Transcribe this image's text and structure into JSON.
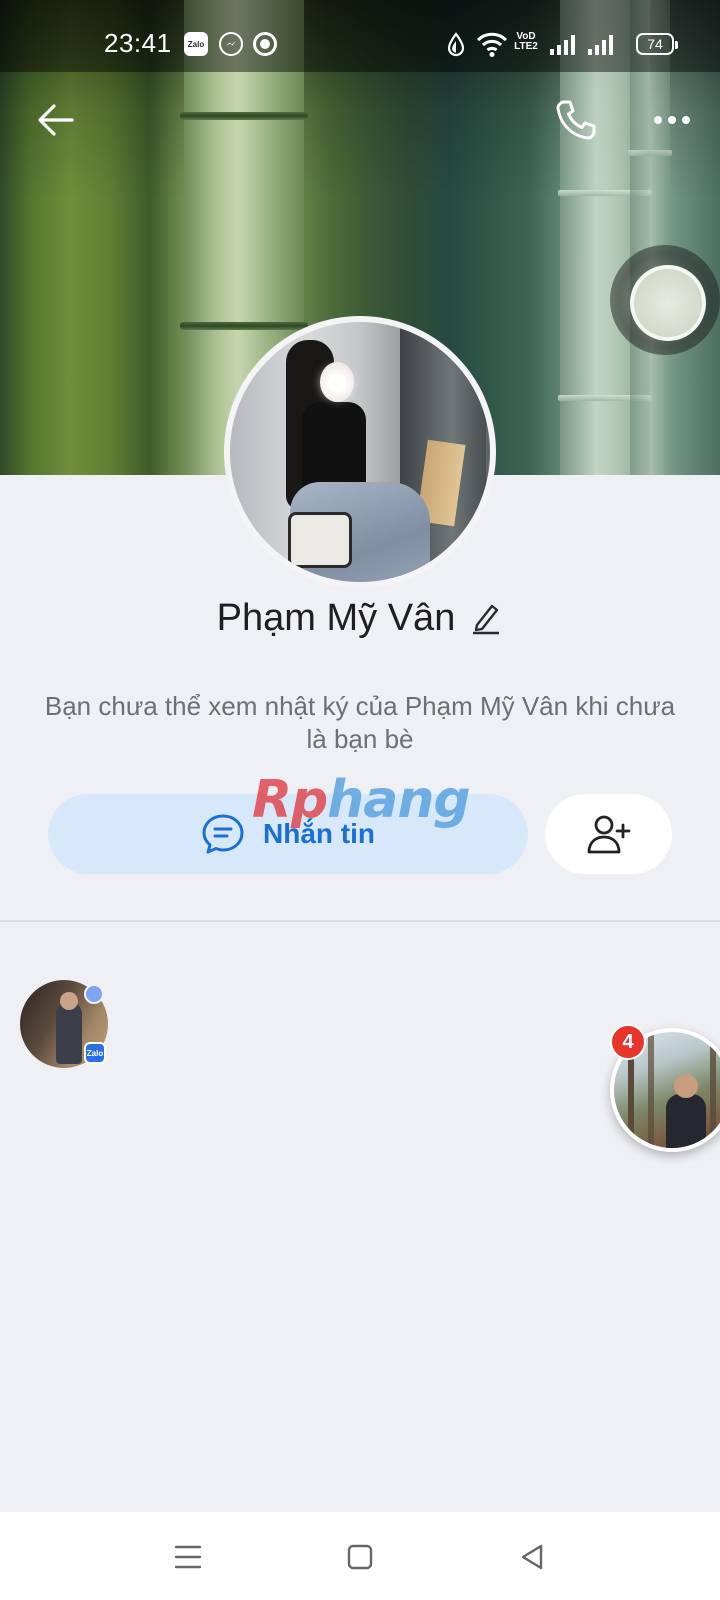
{
  "status_bar": {
    "time": "23:41",
    "battery": "74",
    "app_icons": [
      "zalo-icon",
      "messenger-icon",
      "record-icon"
    ],
    "system_icons": [
      "data-saver-icon",
      "wifi-icon",
      "volte-icon",
      "signal-icon",
      "signal-icon"
    ],
    "volte_label": "VoD LTE2",
    "zalo_label": "Zalo"
  },
  "header": {
    "back_icon": "arrow-left-icon",
    "call_icon": "phone-icon",
    "more_icon": "more-horizontal-icon"
  },
  "profile": {
    "name": "Phạm Mỹ Vân",
    "edit_icon": "pencil-icon",
    "notice": "Bạn chưa thể xem nhật ký của Phạm Mỹ Vân khi chưa là bạn bè"
  },
  "watermark": {
    "part1": "Rp",
    "part2": "hang"
  },
  "actions": {
    "message_label": "Nhắn tin",
    "message_icon": "chat-bubble-icon",
    "add_friend_icon": "add-friend-icon"
  },
  "bubbles": {
    "small_badge": "Zalo",
    "chat_head_count": "4"
  },
  "colors": {
    "accent": "#1a6fd6",
    "message_button_bg": "#d8e8fb",
    "page_bg": "#eff0f4",
    "badge_red": "#e8352b"
  },
  "nav_bar": {
    "icons": [
      "menu-icon",
      "home-square-icon",
      "back-triangle-icon"
    ]
  }
}
